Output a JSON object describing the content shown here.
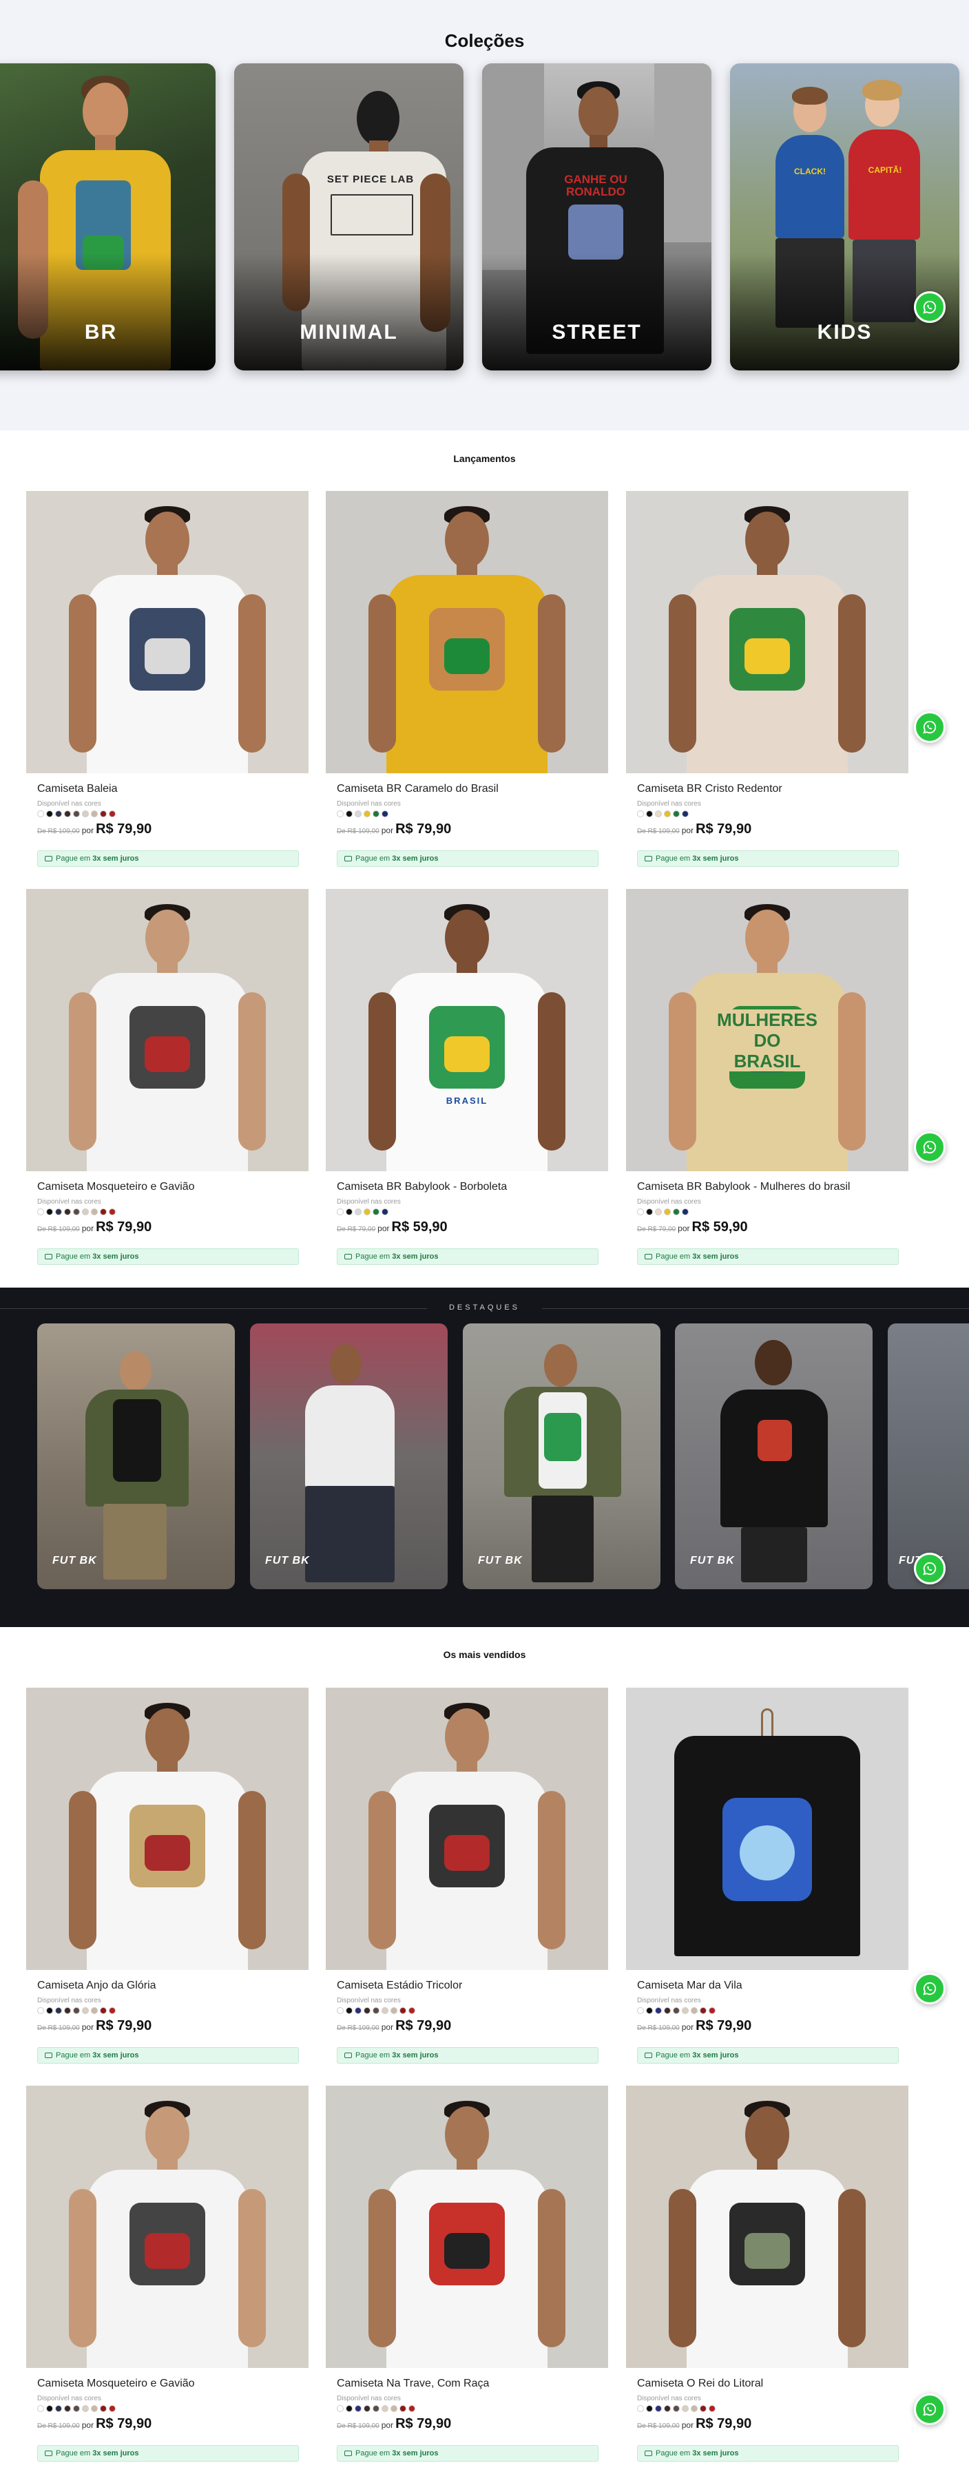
{
  "colecoes": {
    "title": "Coleções",
    "items": [
      {
        "label": "BR"
      },
      {
        "label": "MINIMAL"
      },
      {
        "label": "STREET"
      },
      {
        "label": "KIDS"
      }
    ]
  },
  "shirt_print_texts": {
    "minimal": "SET PIECE LAB",
    "street": "GANHE OU RONALDO",
    "kids_left": "CLACK!",
    "kids_right": "CAPITÃ!",
    "mulheres_line1": "MULHERES",
    "mulheres_line2": "DO",
    "mulheres_line3": "BRASIL",
    "borboleta": "BRASIL"
  },
  "lancamentos": {
    "title": "Lançamentos",
    "products": [
      {
        "name": "Camiseta Baleia",
        "available": "Disponível nas cores",
        "old_price": "De R$ 109,00",
        "por": "por",
        "price": "R$ 79,90",
        "pay_prefix": "Pague em",
        "pay_bold": "3x sem juros",
        "colors": [
          "#ffffff",
          "#111111",
          "#2a2f4a",
          "#3b2a2a",
          "#5a4a4a",
          "#d8cfc0",
          "#c9b8a8",
          "#8b1a1a",
          "#b32020"
        ]
      },
      {
        "name": "Camiseta BR Caramelo do Brasil",
        "available": "Disponível nas cores",
        "old_price": "De R$ 109,00",
        "por": "por",
        "price": "R$ 79,90",
        "pay_prefix": "Pague em",
        "pay_bold": "3x sem juros",
        "colors": [
          "#ffffff",
          "#111111",
          "#d8d8d8",
          "#e8c020",
          "#1d7a3a",
          "#1a2f6a"
        ]
      },
      {
        "name": "Camiseta BR Cristo Redentor",
        "available": "Disponível nas cores",
        "old_price": "De R$ 109,00",
        "por": "por",
        "price": "R$ 79,90",
        "pay_prefix": "Pague em",
        "pay_bold": "3x sem juros",
        "colors": [
          "#ffffff",
          "#111111",
          "#e8dcc8",
          "#e8c020",
          "#1d7a3a",
          "#1a2f6a"
        ]
      },
      {
        "name": "Camiseta Mosqueteiro e Gavião",
        "available": "Disponível nas cores",
        "old_price": "De R$ 109,00",
        "por": "por",
        "price": "R$ 79,90",
        "pay_prefix": "Pague em",
        "pay_bold": "3x sem juros",
        "colors": [
          "#ffffff",
          "#111111",
          "#2a2f4a",
          "#3b2a2a",
          "#5a4a4a",
          "#d8cfc0",
          "#c9b8a8",
          "#8b1a1a",
          "#b32020"
        ]
      },
      {
        "name": "Camiseta BR Babylook - Borboleta",
        "available": "Disponível nas cores",
        "old_price": "De R$ 79,00",
        "por": "por",
        "price": "R$ 59,90",
        "pay_prefix": "Pague em",
        "pay_bold": "3x sem juros",
        "colors": [
          "#ffffff",
          "#111111",
          "#d8d8d8",
          "#e8c020",
          "#1d7a3a",
          "#1a2f6a"
        ]
      },
      {
        "name": "Camiseta BR Babylook - Mulheres do brasil",
        "available": "Disponível nas cores",
        "old_price": "De R$ 79,00",
        "por": "por",
        "price": "R$ 59,90",
        "pay_prefix": "Pague em",
        "pay_bold": "3x sem juros",
        "colors": [
          "#ffffff",
          "#111111",
          "#e8dcc8",
          "#e8c020",
          "#1d7a3a",
          "#1a2f6a"
        ]
      }
    ]
  },
  "destaques": {
    "title": "DESTAQUES",
    "items": [
      {
        "logo": "FUT BK"
      },
      {
        "logo": "FUT BK"
      },
      {
        "logo": "FUT BK"
      },
      {
        "logo": "FUT BK"
      },
      {
        "logo": "FUT BK"
      }
    ]
  },
  "mais_vendidos": {
    "title": "Os mais vendidos",
    "products": [
      {
        "name": "Camiseta Anjo da Glória",
        "available": "Disponível nas cores",
        "old_price": "De R$ 109,00",
        "por": "por",
        "price": "R$ 79,90",
        "pay_prefix": "Pague em",
        "pay_bold": "3x sem juros",
        "colors": [
          "#ffffff",
          "#111111",
          "#2a2f4a",
          "#3b2a2a",
          "#5a4a4a",
          "#d8cfc0",
          "#c9b8a8",
          "#8b1a1a",
          "#b32020"
        ]
      },
      {
        "name": "Camiseta Estádio Tricolor",
        "available": "Disponível nas cores",
        "old_price": "De R$ 109,00",
        "por": "por",
        "price": "R$ 79,90",
        "pay_prefix": "Pague em",
        "pay_bold": "3x sem juros",
        "colors": [
          "#ffffff",
          "#111111",
          "#2a2f7a",
          "#3b2a2a",
          "#5a4a4a",
          "#d8cfc0",
          "#c9b8a8",
          "#8b1a1a",
          "#b32020"
        ]
      },
      {
        "name": "Camiseta Mar da Vila",
        "available": "Disponível nas cores",
        "old_price": "De R$ 109,00",
        "por": "por",
        "price": "R$ 79,90",
        "pay_prefix": "Pague em",
        "pay_bold": "3x sem juros",
        "colors": [
          "#ffffff",
          "#111111",
          "#2a2f7a",
          "#3b2a2a",
          "#5a4a4a",
          "#d8cfc0",
          "#c9b8a8",
          "#8b1a1a",
          "#b32020"
        ]
      },
      {
        "name": "Camiseta Mosqueteiro e Gavião",
        "available": "Disponível nas cores",
        "old_price": "De R$ 109,00",
        "por": "por",
        "price": "R$ 79,90",
        "pay_prefix": "Pague em",
        "pay_bold": "3x sem juros",
        "colors": [
          "#ffffff",
          "#111111",
          "#2a2f4a",
          "#3b2a2a",
          "#5a4a4a",
          "#d8cfc0",
          "#c9b8a8",
          "#8b1a1a",
          "#b32020"
        ]
      },
      {
        "name": "Camiseta Na Trave, Com Raça",
        "available": "Disponível nas cores",
        "old_price": "De R$ 109,00",
        "por": "por",
        "price": "R$ 79,90",
        "pay_prefix": "Pague em",
        "pay_bold": "3x sem juros",
        "colors": [
          "#ffffff",
          "#111111",
          "#2a2f7a",
          "#3b2a2a",
          "#5a4a4a",
          "#d8cfc0",
          "#c9b8a8",
          "#8b1a1a",
          "#b32020"
        ]
      },
      {
        "name": "Camiseta O Rei do Litoral",
        "available": "Disponível nas cores",
        "old_price": "De R$ 109,00",
        "por": "por",
        "price": "R$ 79,90",
        "pay_prefix": "Pague em",
        "pay_bold": "3x sem juros",
        "colors": [
          "#ffffff",
          "#111111",
          "#2a2f7a",
          "#3b2a2a",
          "#5a4a4a",
          "#d8cfc0",
          "#c9b8a8",
          "#8b1a1a",
          "#b32020"
        ]
      }
    ]
  },
  "whatsapp": {
    "icon": "whatsapp-icon",
    "color": "#27c840"
  }
}
